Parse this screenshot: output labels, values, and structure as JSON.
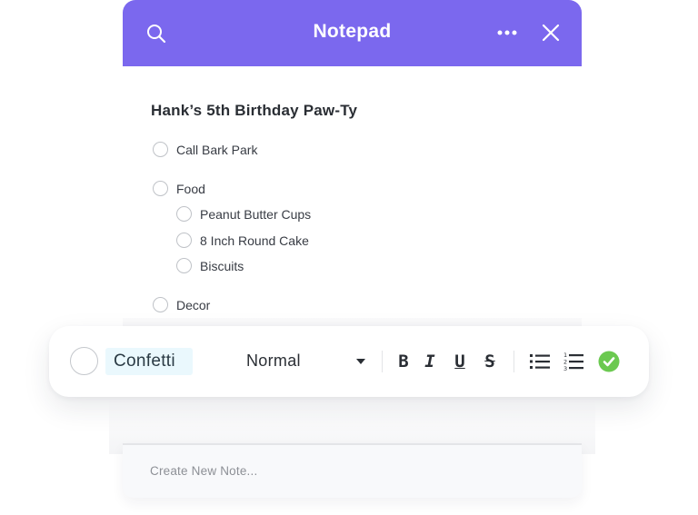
{
  "header": {
    "title": "Notepad",
    "icons": [
      "search-icon",
      "more-icon",
      "close-icon"
    ],
    "accent": "#7b68ee"
  },
  "note": {
    "title": "Hank’s 5th Birthday Paw-Ty",
    "items": [
      {
        "label": "Call Bark Park",
        "level": 0
      },
      {
        "label": "Food",
        "level": 0
      },
      {
        "label": "Peanut Butter Cups",
        "level": 1
      },
      {
        "label": "8 Inch Round Cake",
        "level": 1
      },
      {
        "label": "Biscuits",
        "level": 1
      },
      {
        "label": "Decor",
        "level": 0
      }
    ]
  },
  "toolbar": {
    "input_value": "Confetti",
    "text_style": "Normal",
    "format_buttons": [
      "B",
      "I",
      "U",
      "S"
    ],
    "icons": [
      "bulleted-list-icon",
      "numbered-list-icon",
      "check-circle-icon"
    ],
    "check_color": "#6bc950"
  },
  "new_note": {
    "placeholder": "Create New Note..."
  }
}
